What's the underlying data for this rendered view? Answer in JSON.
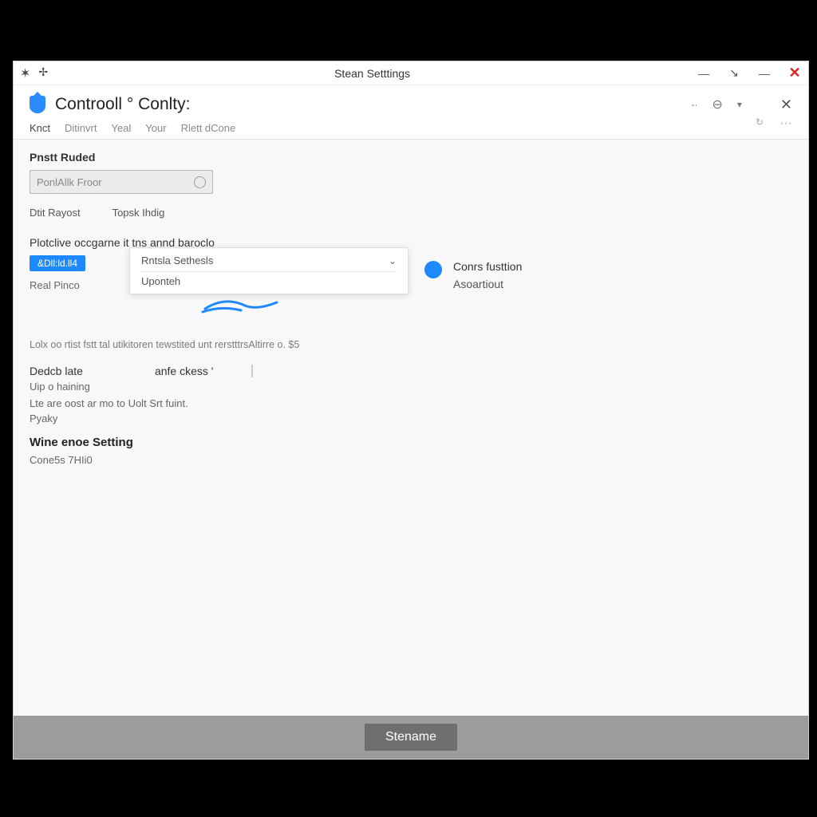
{
  "window": {
    "title": "Stean Setttings"
  },
  "header": {
    "breadcrumb": "Controoll ° Conlty:",
    "tabs": [
      "Knct",
      "Ditinvrt",
      "Yeal",
      "Your",
      "Rlett dCone"
    ]
  },
  "section1": {
    "title": "Pnstt Ruded",
    "search_placeholder": "PonlAllk Froor",
    "link_a": "Dtit Rayost",
    "link_b": "Topsk Ihdig"
  },
  "section2": {
    "desc": "Plotclive occgarne it tns annd baroclo",
    "tag": "&Dll:ld.ll4",
    "under": "Real Pinco"
  },
  "dropdown": {
    "head": "Rntsla Sethesls",
    "body": "Uponteh"
  },
  "toggle": {
    "label": "Conrs fusttion",
    "sub": "Asoartiout"
  },
  "note": "Lolx oo rtist fstt tal utikitoren tewstited unt rerstttrsAltirre o. $5",
  "pair": {
    "a": "Dedcb late",
    "b": "anfe ckess '"
  },
  "lines": {
    "l1": "Uip o haining",
    "l2": "Lte are oost ar mo to Uolt Srt fuint.",
    "l3": "Pyaky"
  },
  "section3": {
    "title": "Wine enoe Setting",
    "value": "Cone5s 7HIi0"
  },
  "footer": {
    "button": "Stename"
  }
}
